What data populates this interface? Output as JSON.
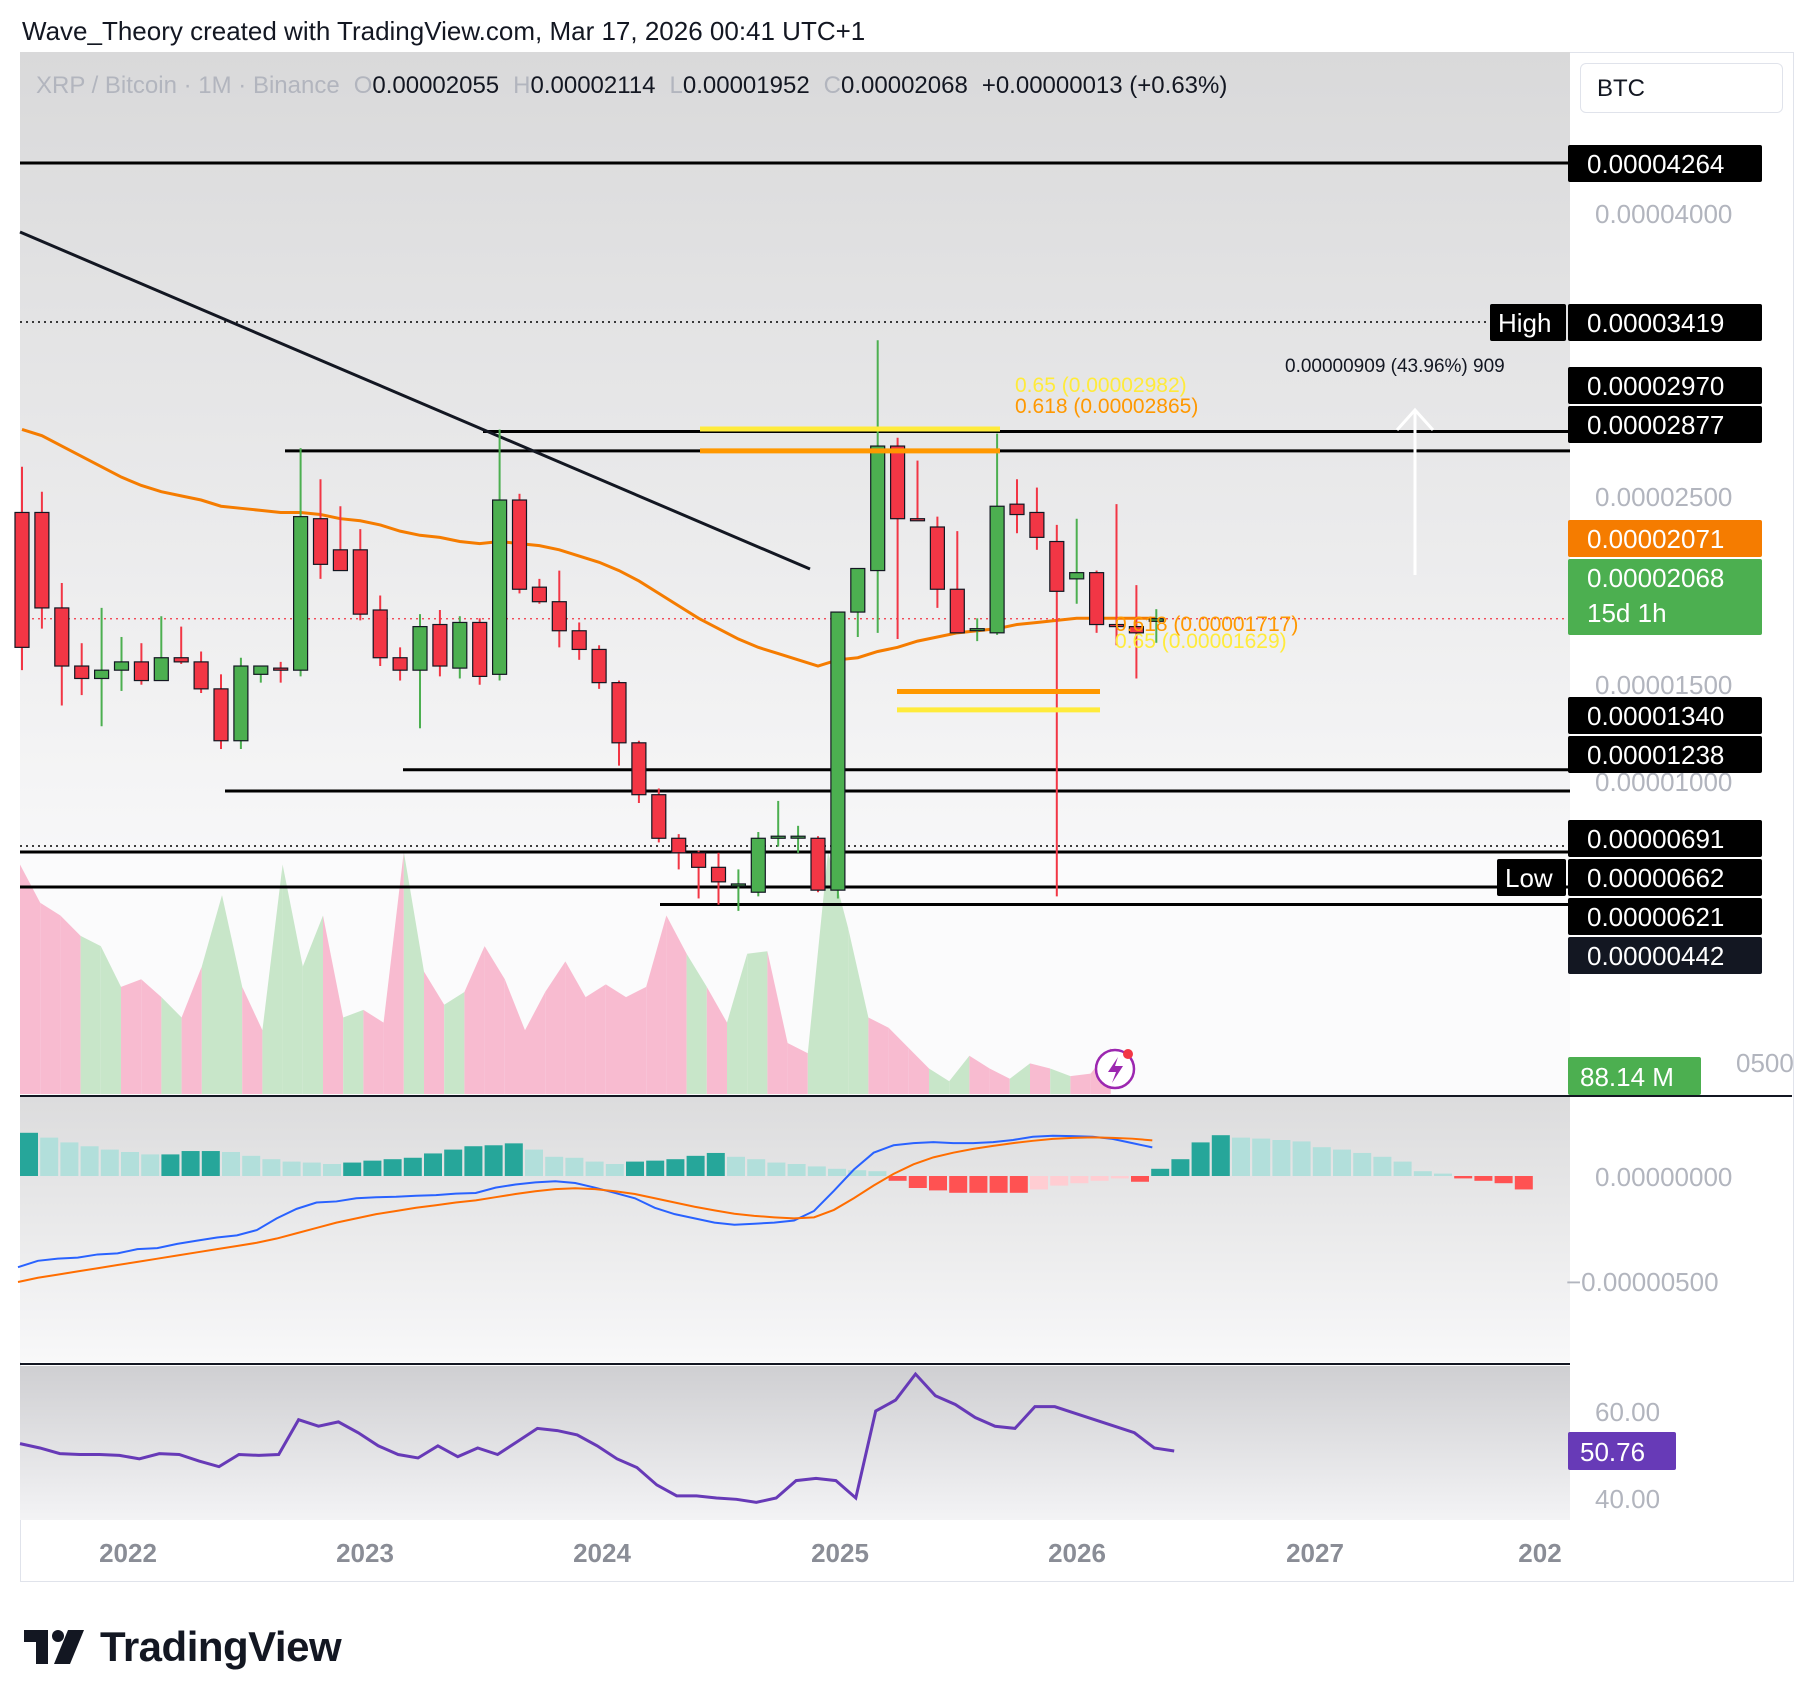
{
  "header": {
    "text": "Wave_Theory created with TradingView.com, Mar 17, 2026 00:41 UTC+1"
  },
  "symbol_bar": {
    "symbol": "XRP / Bitcoin · 1M · Binance",
    "o_label": "O",
    "o_value": "0.00002055",
    "h_label": "H",
    "h_value": "0.00002114",
    "l_label": "L",
    "l_value": "0.00001952",
    "c_label": "C",
    "c_value": "0.00002068",
    "change": "+0.00000013 (+0.63%)"
  },
  "currency": "BTC",
  "footer": {
    "brand": "TradingView"
  },
  "colors": {
    "up": "#4caf50",
    "down": "#f23645",
    "ema": "#f57c00",
    "fib_618": "#ff9800",
    "fib_65": "#ffeb3b",
    "macd": "#2962ff",
    "signal": "#ff6d00",
    "rsi": "#673ab7",
    "volume_up": "#c8e6c9",
    "volume_down": "#f8bbd0"
  },
  "chart_data": {
    "type": "candlestick",
    "symbol": "XRP / Bitcoin",
    "interval": "1M",
    "exchange": "Binance",
    "x_ticks": [
      "2022",
      "2023",
      "2024",
      "2025",
      "2026",
      "2027",
      "202"
    ],
    "price_ticks": [
      "0.00004000",
      "0.00002500",
      "0.00001500",
      "0.00001000"
    ],
    "candles": [
      {
        "o": 2.58,
        "h": 2.8,
        "l": 1.82,
        "c": 1.93
      },
      {
        "o": 2.58,
        "h": 2.68,
        "l": 2.02,
        "c": 2.12
      },
      {
        "o": 2.12,
        "h": 2.24,
        "l": 1.65,
        "c": 1.84
      },
      {
        "o": 1.84,
        "h": 1.95,
        "l": 1.7,
        "c": 1.78
      },
      {
        "o": 1.78,
        "h": 2.12,
        "l": 1.55,
        "c": 1.82
      },
      {
        "o": 1.82,
        "h": 1.98,
        "l": 1.72,
        "c": 1.86
      },
      {
        "o": 1.86,
        "h": 1.95,
        "l": 1.75,
        "c": 1.77
      },
      {
        "o": 1.77,
        "h": 2.08,
        "l": 1.78,
        "c": 1.88
      },
      {
        "o": 1.88,
        "h": 2.03,
        "l": 1.85,
        "c": 1.86
      },
      {
        "o": 1.86,
        "h": 1.91,
        "l": 1.71,
        "c": 1.73
      },
      {
        "o": 1.73,
        "h": 1.8,
        "l": 1.44,
        "c": 1.48
      },
      {
        "o": 1.48,
        "h": 1.88,
        "l": 1.44,
        "c": 1.84
      },
      {
        "o": 1.8,
        "h": 1.84,
        "l": 1.76,
        "c": 1.84
      },
      {
        "o": 1.83,
        "h": 1.86,
        "l": 1.76,
        "c": 1.82
      },
      {
        "o": 1.82,
        "h": 2.89,
        "l": 1.79,
        "c": 2.56
      },
      {
        "o": 2.55,
        "h": 2.74,
        "l": 2.26,
        "c": 2.33
      },
      {
        "o": 2.4,
        "h": 2.61,
        "l": 2.3,
        "c": 2.3
      },
      {
        "o": 2.4,
        "h": 2.5,
        "l": 2.06,
        "c": 2.09
      },
      {
        "o": 2.11,
        "h": 2.18,
        "l": 1.84,
        "c": 1.88
      },
      {
        "o": 1.88,
        "h": 1.93,
        "l": 1.77,
        "c": 1.82
      },
      {
        "o": 1.82,
        "h": 2.09,
        "l": 1.54,
        "c": 2.03
      },
      {
        "o": 2.04,
        "h": 2.11,
        "l": 1.79,
        "c": 1.84
      },
      {
        "o": 1.83,
        "h": 2.08,
        "l": 1.78,
        "c": 2.05
      },
      {
        "o": 2.05,
        "h": 2.07,
        "l": 1.75,
        "c": 1.79
      },
      {
        "o": 1.8,
        "h": 2.98,
        "l": 1.77,
        "c": 2.64
      },
      {
        "o": 2.64,
        "h": 2.67,
        "l": 2.19,
        "c": 2.21
      },
      {
        "o": 2.22,
        "h": 2.26,
        "l": 2.14,
        "c": 2.15
      },
      {
        "o": 2.15,
        "h": 2.3,
        "l": 1.93,
        "c": 2.01
      },
      {
        "o": 2.01,
        "h": 2.05,
        "l": 1.87,
        "c": 1.92
      },
      {
        "o": 1.92,
        "h": 1.94,
        "l": 1.73,
        "c": 1.76
      },
      {
        "o": 1.76,
        "h": 1.77,
        "l": 1.36,
        "c": 1.47
      },
      {
        "o": 1.47,
        "h": 1.48,
        "l": 1.18,
        "c": 1.22
      },
      {
        "o": 1.22,
        "h": 1.25,
        "l": 0.99,
        "c": 1.01
      },
      {
        "o": 1.01,
        "h": 1.03,
        "l": 0.86,
        "c": 0.94
      },
      {
        "o": 0.94,
        "h": 0.95,
        "l": 0.72,
        "c": 0.87
      },
      {
        "o": 0.87,
        "h": 0.94,
        "l": 0.69,
        "c": 0.8
      },
      {
        "o": 0.79,
        "h": 0.86,
        "l": 0.66,
        "c": 0.79
      },
      {
        "o": 0.75,
        "h": 1.04,
        "l": 0.73,
        "c": 1.01
      },
      {
        "o": 1.01,
        "h": 1.19,
        "l": 0.97,
        "c": 1.02
      },
      {
        "o": 1.02,
        "h": 1.07,
        "l": 0.94,
        "c": 1.02
      },
      {
        "o": 1.01,
        "h": 1.02,
        "l": 0.75,
        "c": 0.76
      },
      {
        "o": 0.76,
        "h": 2.1,
        "l": 0.72,
        "c": 2.1
      },
      {
        "o": 2.1,
        "h": 2.3,
        "l": 1.98,
        "c": 2.31
      },
      {
        "o": 2.3,
        "h": 3.41,
        "l": 2.0,
        "c": 2.9
      },
      {
        "o": 2.9,
        "h": 2.94,
        "l": 1.97,
        "c": 2.55
      },
      {
        "o": 2.55,
        "h": 2.83,
        "l": 2.54,
        "c": 2.54
      },
      {
        "o": 2.51,
        "h": 2.56,
        "l": 2.12,
        "c": 2.21
      },
      {
        "o": 2.21,
        "h": 2.49,
        "l": 2.09,
        "c": 2.0
      },
      {
        "o": 2.02,
        "h": 2.07,
        "l": 1.96,
        "c": 2.02
      },
      {
        "o": 2.0,
        "h": 2.96,
        "l": 1.99,
        "c": 2.61
      },
      {
        "o": 2.62,
        "h": 2.74,
        "l": 2.48,
        "c": 2.57
      },
      {
        "o": 2.58,
        "h": 2.7,
        "l": 2.4,
        "c": 2.46
      },
      {
        "o": 2.44,
        "h": 2.52,
        "l": 0.73,
        "c": 2.2
      },
      {
        "o": 2.26,
        "h": 2.55,
        "l": 2.14,
        "c": 2.29
      },
      {
        "o": 2.29,
        "h": 2.3,
        "l": 2.0,
        "c": 2.04
      },
      {
        "o": 2.04,
        "h": 2.62,
        "l": 1.94,
        "c": 2.03
      },
      {
        "o": 2.03,
        "h": 2.23,
        "l": 1.78,
        "c": 2.0
      },
      {
        "o": 2.0555,
        "h": 2.114,
        "l": 1.952,
        "c": 2.068
      }
    ],
    "ema": [
      2.98,
      2.95,
      2.9,
      2.85,
      2.8,
      2.75,
      2.71,
      2.68,
      2.66,
      2.64,
      2.61,
      2.6,
      2.59,
      2.58,
      2.58,
      2.57,
      2.55,
      2.54,
      2.52,
      2.49,
      2.47,
      2.46,
      2.44,
      2.43,
      2.44,
      2.43,
      2.42,
      2.4,
      2.37,
      2.34,
      2.3,
      2.25,
      2.19,
      2.13,
      2.07,
      2.02,
      1.97,
      1.93,
      1.9,
      1.87,
      1.84,
      1.87,
      1.88,
      1.91,
      1.93,
      1.96,
      1.98,
      2.0,
      2.01,
      2.02,
      2.04,
      2.05,
      2.06,
      2.07,
      2.07,
      2.07,
      2.07,
      2.07
    ],
    "horizontal_levels": [
      {
        "label": "0.00004264",
        "color": "#000000",
        "text_color": "#ffffff"
      },
      {
        "label": "0.00003419",
        "tag": "High",
        "color": "#000000",
        "text_color": "#ffffff"
      },
      {
        "label": "0.00002970",
        "color": "#000000",
        "text_color": "#ffffff"
      },
      {
        "label": "0.00002877",
        "color": "#000000",
        "text_color": "#ffffff"
      },
      {
        "label": "0.00002071",
        "color": "#f57c00",
        "text_color": "#ffffff"
      },
      {
        "label": "0.00002068",
        "sub": "15d 1h",
        "color": "#4caf50",
        "text_color": "#ffffff"
      },
      {
        "label": "0.00001340",
        "color": "#000000",
        "text_color": "#ffffff"
      },
      {
        "label": "0.00001238",
        "color": "#000000",
        "text_color": "#ffffff"
      },
      {
        "label": "0.00000691",
        "color": "#000000",
        "text_color": "#ffffff"
      },
      {
        "label": "0.00000662",
        "tag": "Low",
        "color": "#000000",
        "text_color": "#ffffff"
      },
      {
        "label": "0.00000621",
        "color": "#000000",
        "text_color": "#ffffff"
      },
      {
        "label": "0.00000442",
        "color": "#131722",
        "text_color": "#ffffff"
      }
    ],
    "fib_annotations": [
      {
        "text": "0.65 (0.00002982)",
        "color": "#ffeb3b"
      },
      {
        "text": "0.618 (0.00002865)",
        "color": "#ff9800"
      },
      {
        "text": "0.618 (0.00001717)",
        "color": "#ff9800"
      },
      {
        "text": "0.65 (0.00001629)",
        "color": "#ffeb3b"
      }
    ],
    "measure_label": "0.00000909 (43.96%) 909",
    "volume": {
      "last_label": "88.14 M",
      "axis_label": "0500",
      "values": [
        0.9,
        0.75,
        0.7,
        0.62,
        0.58,
        0.42,
        0.45,
        0.38,
        0.3,
        0.5,
        0.78,
        0.42,
        0.25,
        0.9,
        0.5,
        0.7,
        0.3,
        0.33,
        0.28,
        0.95,
        0.48,
        0.35,
        0.4,
        0.58,
        0.45,
        0.25,
        0.4,
        0.52,
        0.38,
        0.43,
        0.38,
        0.42,
        0.7,
        0.55,
        0.42,
        0.28,
        0.55,
        0.56,
        0.2,
        0.16,
        0.95,
        0.65,
        0.3,
        0.26,
        0.18,
        0.1,
        0.05,
        0.15,
        0.1,
        0.06,
        0.12,
        0.1,
        0.07,
        0.08,
        0.18
      ],
      "up": [
        false,
        false,
        false,
        true,
        true,
        false,
        false,
        true,
        false,
        true,
        true,
        false,
        true,
        true,
        true,
        false,
        true,
        false,
        false,
        true,
        false,
        true,
        false,
        false,
        false,
        false,
        false,
        false,
        false,
        false,
        false,
        false,
        false,
        true,
        false,
        true,
        true,
        false,
        false,
        true,
        true,
        true,
        false,
        false,
        false,
        true,
        true,
        false,
        false,
        true,
        false,
        true,
        false,
        false,
        false
      ]
    },
    "macd": {
      "zero_label": "0.00000000",
      "neg_label": "−0.00000500",
      "macd": [
        -4.3,
        -4.0,
        -3.9,
        -3.85,
        -3.7,
        -3.65,
        -3.45,
        -3.4,
        -3.2,
        -3.05,
        -2.9,
        -2.8,
        -2.55,
        -2.0,
        -1.55,
        -1.25,
        -1.2,
        -1.05,
        -1.0,
        -0.98,
        -0.93,
        -0.9,
        -0.83,
        -0.8,
        -0.55,
        -0.4,
        -0.3,
        -0.25,
        -0.33,
        -0.55,
        -0.8,
        -1.05,
        -1.5,
        -1.8,
        -2.0,
        -2.2,
        -2.3,
        -2.25,
        -2.2,
        -2.1,
        -1.65,
        -0.7,
        0.3,
        1.1,
        1.45,
        1.55,
        1.6,
        1.55,
        1.55,
        1.6,
        1.7,
        1.85,
        1.9,
        1.88,
        1.85,
        1.75,
        1.55,
        1.35
      ],
      "signal": [
        -5.0,
        -4.8,
        -4.65,
        -4.5,
        -4.35,
        -4.2,
        -4.05,
        -3.9,
        -3.75,
        -3.6,
        -3.45,
        -3.3,
        -3.15,
        -2.95,
        -2.7,
        -2.45,
        -2.2,
        -2.0,
        -1.8,
        -1.65,
        -1.5,
        -1.38,
        -1.25,
        -1.15,
        -1.0,
        -0.85,
        -0.72,
        -0.62,
        -0.58,
        -0.62,
        -0.72,
        -0.85,
        -1.05,
        -1.25,
        -1.45,
        -1.62,
        -1.78,
        -1.88,
        -1.95,
        -2.0,
        -1.95,
        -1.6,
        -1.05,
        -0.45,
        0.1,
        0.55,
        0.88,
        1.1,
        1.28,
        1.42,
        1.55,
        1.66,
        1.75,
        1.8,
        1.82,
        1.8,
        1.76,
        1.68
      ],
      "hist": [
        0.9,
        0.8,
        0.7,
        0.62,
        0.55,
        0.5,
        0.45,
        0.45,
        0.52,
        0.52,
        0.5,
        0.42,
        0.35,
        0.3,
        0.28,
        0.25,
        0.28,
        0.32,
        0.35,
        0.38,
        0.47,
        0.55,
        0.62,
        0.64,
        0.68,
        0.55,
        0.4,
        0.38,
        0.3,
        0.25,
        0.3,
        0.32,
        0.35,
        0.42,
        0.48,
        0.4,
        0.35,
        0.28,
        0.25,
        0.2,
        0.15,
        0.12,
        0.1,
        -0.1,
        -0.25,
        -0.3,
        -0.35,
        -0.35,
        -0.35,
        -0.35,
        -0.28,
        -0.2,
        -0.15,
        -0.1,
        -0.05,
        -0.12,
        0.15,
        0.35,
        0.7,
        0.85,
        0.8,
        0.78,
        0.75,
        0.72,
        0.6,
        0.55,
        0.48,
        0.4,
        0.3,
        0.1,
        0.05,
        -0.05,
        -0.1,
        -0.15,
        -0.28
      ]
    },
    "rsi": {
      "ticks": [
        "60.00",
        "40.00"
      ],
      "last_label": "50.76",
      "values": [
        52.5,
        51.5,
        50.2,
        50.0,
        50.0,
        49.8,
        49.0,
        50.2,
        50.0,
        48.5,
        47.2,
        50.0,
        49.8,
        50.0,
        58.0,
        56.5,
        57.5,
        55.0,
        52.0,
        50.0,
        49.2,
        52.0,
        49.5,
        51.5,
        50.0,
        53.0,
        56.0,
        55.5,
        54.5,
        52.0,
        49.0,
        47.0,
        43.0,
        40.5,
        40.5,
        40.0,
        39.7,
        39.0,
        40.0,
        44.0,
        44.5,
        44.0,
        40.0,
        60.0,
        62.5,
        68.5,
        63.5,
        61.5,
        58.5,
        56.5,
        56.0,
        61.0,
        61.0,
        59.5,
        58.0,
        56.5,
        55.0,
        51.5,
        50.8
      ]
    }
  }
}
